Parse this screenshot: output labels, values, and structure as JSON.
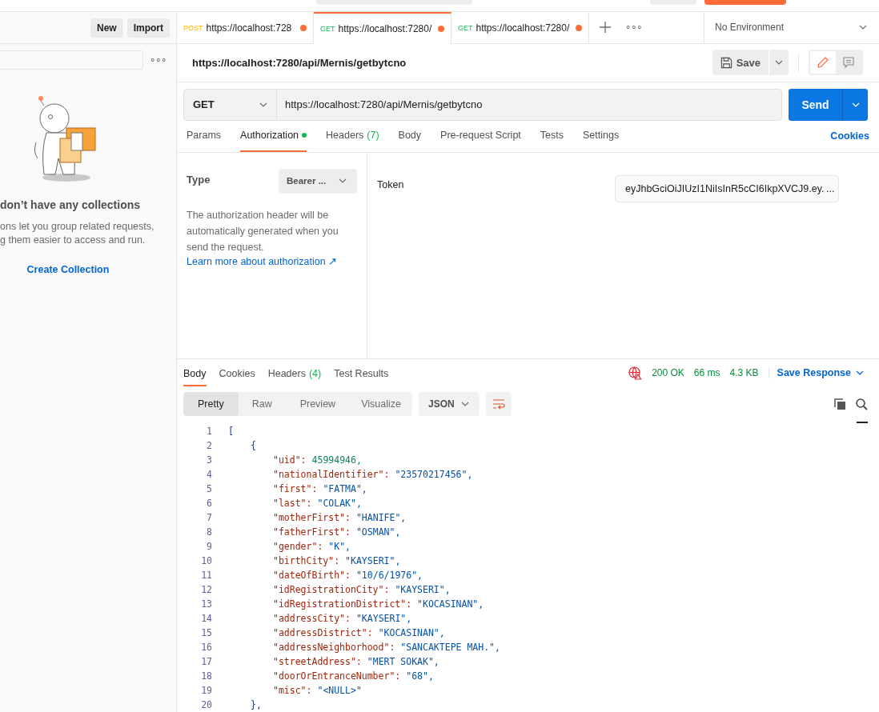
{
  "sidebar": {
    "buttons": [
      "New",
      "Import"
    ],
    "more": "∘∘∘",
    "empty_title": "don’t have any collections",
    "empty_lines": [
      "ons let you group related requests,",
      "g them easier to access and run."
    ],
    "create_link": "Create Collection"
  },
  "tabs": [
    {
      "method": "POST",
      "url": "https://localhost:728",
      "unsaved": true,
      "selected": false
    },
    {
      "method": "GET",
      "url": "https://localhost:7280/",
      "unsaved": true,
      "selected": true
    },
    {
      "method": "GET",
      "url": "https://localhost:7280/",
      "unsaved": true,
      "selected": false
    }
  ],
  "tab_more": "∘∘∘",
  "environment": "No Environment",
  "request": {
    "title": "https://localhost:7280/api/Mernis/getbytcno",
    "save": "Save",
    "method": "GET",
    "url": "https://localhost:7280/api/Mernis/getbytcno",
    "send": "Send"
  },
  "request_tabs": [
    {
      "label": "Params",
      "selected": false,
      "dot": false
    },
    {
      "label": "Authorization",
      "selected": true,
      "dot": true
    },
    {
      "label": "Headers",
      "count": "(7)",
      "selected": false,
      "dot": false
    },
    {
      "label": "Body",
      "selected": false,
      "dot": false
    },
    {
      "label": "Pre-request Script",
      "selected": false,
      "dot": false
    },
    {
      "label": "Tests",
      "selected": false,
      "dot": false
    },
    {
      "label": "Settings",
      "selected": false,
      "dot": false
    }
  ],
  "cookies_link": "Cookies",
  "auth": {
    "type_label": "Type",
    "type_value": "Bearer ...",
    "description": "The authorization header will be automatically generated when you send the request.",
    "learn_link": "Learn more about authorization ↗",
    "token_label": "Token",
    "token_value": "eyJhbGciOiJIUzI1NiIsInR5cCI6IkpXVCJ9.ey. ..."
  },
  "response_tabs": [
    {
      "label": "Body",
      "selected": true
    },
    {
      "label": "Cookies",
      "selected": false
    },
    {
      "label": "Headers",
      "count": "(4)",
      "selected": false
    },
    {
      "label": "Test Results",
      "selected": false
    }
  ],
  "response_status": {
    "status": "200 OK",
    "time": "66 ms",
    "size": "4.3 KB",
    "save": "Save Response"
  },
  "view_modes": [
    {
      "label": "Pretty",
      "selected": true
    },
    {
      "label": "Raw",
      "selected": false
    },
    {
      "label": "Preview",
      "selected": false
    },
    {
      "label": "Visualize",
      "selected": false
    }
  ],
  "format": "JSON",
  "code_lines": [
    {
      "number": "1",
      "kind": "open-array",
      "text": "["
    },
    {
      "number": "2",
      "kind": "open-object",
      "text": "{"
    },
    {
      "number": "3",
      "kind": "pair",
      "key": "\"uid\":",
      "value": "45994946,",
      "numeric": true
    },
    {
      "number": "4",
      "kind": "pair",
      "key": "\"nationalIdentifier\":",
      "value": "\"23570217456\",",
      "numeric": false
    },
    {
      "number": "5",
      "kind": "pair",
      "key": "\"first\":",
      "value": "\"FATMA\",",
      "numeric": false
    },
    {
      "number": "6",
      "kind": "pair",
      "key": "\"last\":",
      "value": "\"COLAK\",",
      "numeric": false
    },
    {
      "number": "7",
      "kind": "pair",
      "key": "\"motherFirst\":",
      "value": "\"HANIFE\",",
      "numeric": false
    },
    {
      "number": "8",
      "kind": "pair",
      "key": "\"fatherFirst\":",
      "value": "\"OSMAN\",",
      "numeric": false
    },
    {
      "number": "9",
      "kind": "pair",
      "key": "\"gender\":",
      "value": "\"K\",",
      "numeric": false
    },
    {
      "number": "10",
      "kind": "pair",
      "key": "\"birthCity\":",
      "value": "\"KAYSERI\",",
      "numeric": false
    },
    {
      "number": "11",
      "kind": "pair",
      "key": "\"dateOfBirth\":",
      "value": "\"10/6/1976\",",
      "numeric": false
    },
    {
      "number": "12",
      "kind": "pair",
      "key": "\"idRegistrationCity\":",
      "value": "\"KAYSERI\",",
      "numeric": false
    },
    {
      "number": "13",
      "kind": "pair",
      "key": "\"idRegistrationDistrict\":",
      "value": "\"KOCASINAN\",",
      "numeric": false
    },
    {
      "number": "14",
      "kind": "pair",
      "key": "\"addressCity\":",
      "value": "\"KAYSERI\",",
      "numeric": false
    },
    {
      "number": "15",
      "kind": "pair",
      "key": "\"addressDistrict\":",
      "value": "\"KOCASINAN\",",
      "numeric": false
    },
    {
      "number": "16",
      "kind": "pair",
      "key": "\"addressNeighborhood\":",
      "value": "\"SANCAKTEPE MAH.\",",
      "numeric": false
    },
    {
      "number": "17",
      "kind": "pair",
      "key": "\"streetAddress\":",
      "value": "\"MERT SOKAK\",",
      "numeric": false
    },
    {
      "number": "18",
      "kind": "pair",
      "key": "\"doorOrEntranceNumber\":",
      "value": "\"68\",",
      "numeric": false
    },
    {
      "number": "19",
      "kind": "pair",
      "key": "\"misc\":",
      "value": "\"<NULL>\"",
      "numeric": false
    },
    {
      "number": "20",
      "kind": "close-object",
      "text": "},"
    }
  ]
}
